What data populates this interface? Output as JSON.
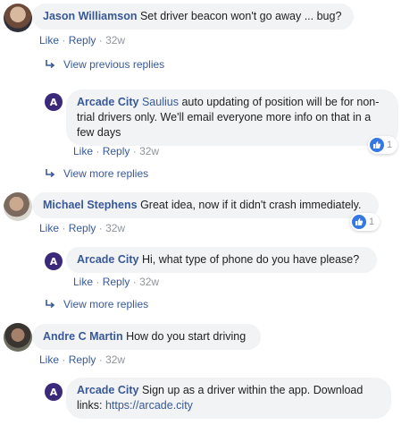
{
  "comments": [
    {
      "author": "Jason Williamson",
      "text": "Set driver beacon won't go away ... bug?",
      "like_label": "Like",
      "reply_label": "Reply",
      "time": "32w",
      "avatar_icon": "user-avatar-photo"
    },
    {
      "author": "Michael Stephens",
      "text": "Great idea, now if it didn't crash immediately.",
      "like_label": "Like",
      "reply_label": "Reply",
      "time": "32w",
      "reaction_count": "1",
      "avatar_icon": "user-avatar-photo"
    },
    {
      "author": "Andre C Martin",
      "text": "How do you start driving",
      "like_label": "Like",
      "reply_label": "Reply",
      "time": "32w",
      "avatar_icon": "user-avatar-photo"
    }
  ],
  "replies": [
    {
      "author": "Arcade City",
      "mention": "Saulius",
      "text_line1": " auto updating of position will be for non-",
      "text_line2": "trial drivers only. We'll email everyone more info on that in a",
      "text_line3": "few days",
      "like_label": "Like",
      "reply_label": "Reply",
      "time": "32w",
      "reaction_count": "1",
      "avatar_icon": "arcade-city-logo"
    },
    {
      "author": "Arcade City",
      "text": "Hi, what type of phone do you have please?",
      "like_label": "Like",
      "reply_label": "Reply",
      "time": "32w",
      "avatar_icon": "arcade-city-logo"
    },
    {
      "author": "Arcade City",
      "text_line1": "Sign up as a driver within the app. Download",
      "text_line2_prefix": "links: ",
      "link": "https://arcade.city",
      "avatar_icon": "arcade-city-logo"
    }
  ],
  "reply_toggles": {
    "previous": "View previous replies",
    "more_1": "View more replies",
    "more_2": "View more replies"
  },
  "separator": "·",
  "colors": {
    "link_blue": "#385898",
    "bubble_gray": "#f2f3f5",
    "meta_gray": "#90949c",
    "like_blue": "#3578e5",
    "arcade_purple": "#3b2a7a"
  }
}
